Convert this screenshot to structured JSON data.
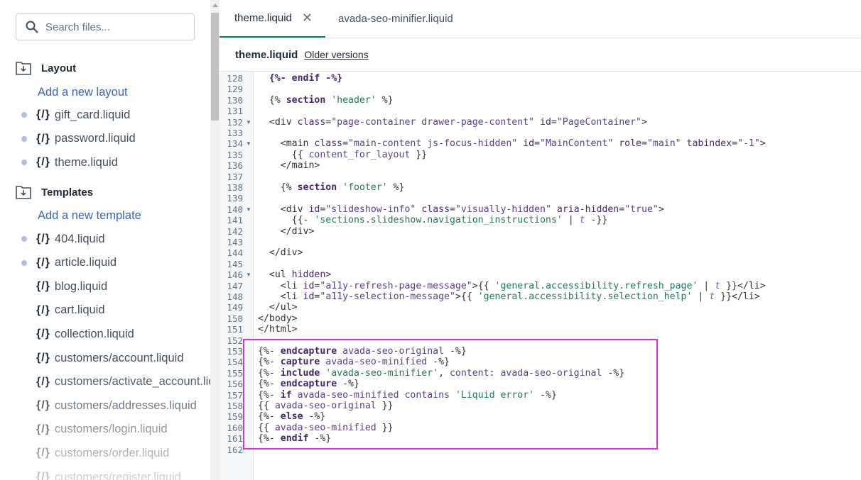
{
  "sidebar": {
    "search_placeholder": "Search files...",
    "layout": {
      "title": "Layout",
      "add_label": "Add a new layout",
      "files": [
        {
          "name": "gift_card.liquid",
          "modified": true
        },
        {
          "name": "password.liquid",
          "modified": true
        },
        {
          "name": "theme.liquid",
          "modified": true
        }
      ]
    },
    "templates": {
      "title": "Templates",
      "add_label": "Add a new template",
      "files": [
        {
          "name": "404.liquid",
          "modified": true
        },
        {
          "name": "article.liquid",
          "modified": true
        },
        {
          "name": "blog.liquid",
          "modified": false
        },
        {
          "name": "cart.liquid",
          "modified": false
        },
        {
          "name": "collection.liquid",
          "modified": false
        },
        {
          "name": "customers/account.liquid",
          "modified": false
        },
        {
          "name": "customers/activate_account.liquid",
          "modified": false
        },
        {
          "name": "customers/addresses.liquid",
          "modified": false
        },
        {
          "name": "customers/login.liquid",
          "modified": false
        },
        {
          "name": "customers/order.liquid",
          "modified": false
        },
        {
          "name": "customers/register.liquid",
          "modified": false
        }
      ]
    },
    "file_icon_text": "{/}"
  },
  "tabs": [
    {
      "label": "theme.liquid",
      "active": true,
      "close": "✕"
    },
    {
      "label": "avada-seo-minifier.liquid",
      "active": false
    }
  ],
  "file_header": {
    "name": "theme.liquid",
    "older_versions": "Older versions"
  },
  "code_lines": [
    {
      "n": "128",
      "fold": false,
      "html": "  <span class='k'>{%- endif -%}</span>"
    },
    {
      "n": "129",
      "fold": false,
      "html": ""
    },
    {
      "n": "130",
      "fold": false,
      "html": "  {% <span class='k'>section</span> <span class='s'>'header'</span> %}"
    },
    {
      "n": "131",
      "fold": false,
      "html": ""
    },
    {
      "n": "132",
      "fold": true,
      "html": "  &lt;div <span class='a'>class</span>=<span class='v'>\"page-container drawer-page-content\"</span> <span class='a'>id</span>=<span class='v'>\"PageContainer\"</span>&gt;"
    },
    {
      "n": "133",
      "fold": false,
      "html": ""
    },
    {
      "n": "134",
      "fold": true,
      "html": "    &lt;main <span class='a'>class</span>=<span class='v'>\"main-content js-focus-hidden\"</span> <span class='a'>id</span>=<span class='v'>\"MainContent\"</span> <span class='a'>role</span>=<span class='v'>\"main\"</span> <span class='a'>tabindex</span>=<span class='v'>\"-1\"</span>&gt;"
    },
    {
      "n": "135",
      "fold": false,
      "html": "      {{ <span class='v'>content_for_layout</span> }}"
    },
    {
      "n": "136",
      "fold": false,
      "html": "    &lt;/main&gt;"
    },
    {
      "n": "137",
      "fold": false,
      "html": ""
    },
    {
      "n": "138",
      "fold": false,
      "html": "    {% <span class='k'>section</span> <span class='s'>'footer'</span> %}"
    },
    {
      "n": "139",
      "fold": false,
      "html": ""
    },
    {
      "n": "140",
      "fold": true,
      "html": "    &lt;div <span class='a'>id</span>=<span class='v'>\"slideshow-info\"</span> <span class='a'>class</span>=<span class='v'>\"visually-hidden\"</span> <span class='a'>aria-hidden</span>=<span class='v'>\"true\"</span>&gt;"
    },
    {
      "n": "141",
      "fold": false,
      "html": "      {{- <span class='s'>'sections.slideshow.navigation_instructions'</span> | <span class='f'>t</span> -}}"
    },
    {
      "n": "142",
      "fold": false,
      "html": "    &lt;/div&gt;"
    },
    {
      "n": "143",
      "fold": false,
      "html": ""
    },
    {
      "n": "144",
      "fold": false,
      "html": "  &lt;/div&gt;"
    },
    {
      "n": "145",
      "fold": false,
      "html": ""
    },
    {
      "n": "146",
      "fold": true,
      "html": "  &lt;ul <span class='a'>hidden</span>&gt;"
    },
    {
      "n": "147",
      "fold": false,
      "html": "    &lt;li <span class='a'>id</span>=<span class='v'>\"a11y-refresh-page-message\"</span>&gt;{{ <span class='s'>'general.accessibility.refresh_page'</span> | <span class='f'>t</span> }}&lt;/li&gt;"
    },
    {
      "n": "148",
      "fold": false,
      "html": "    &lt;li <span class='a'>id</span>=<span class='v'>\"a11y-selection-message\"</span>&gt;{{ <span class='s'>'general.accessibility.selection_help'</span> | <span class='f'>t</span> }}&lt;/li&gt;"
    },
    {
      "n": "149",
      "fold": false,
      "html": "  &lt;/ul&gt;"
    },
    {
      "n": "150",
      "fold": false,
      "html": "&lt;/body&gt;"
    },
    {
      "n": "151",
      "fold": false,
      "html": "&lt;/html&gt;"
    },
    {
      "n": "152",
      "fold": false,
      "html": ""
    },
    {
      "n": "153",
      "fold": false,
      "html": "{%- <span class='k'>endcapture</span> <span class='v'>avada-seo-original</span> -%}"
    },
    {
      "n": "154",
      "fold": false,
      "html": "{%- <span class='k'>capture</span> <span class='v'>avada-seo-minified</span> -%}"
    },
    {
      "n": "155",
      "fold": false,
      "html": "{%- <span class='k'>include</span> <span class='s'>'avada-seo-minifier'</span>, <span class='v'>content</span>: <span class='v'>avada-seo-original</span> -%}"
    },
    {
      "n": "156",
      "fold": false,
      "html": "{%- <span class='k'>endcapture</span> -%}"
    },
    {
      "n": "157",
      "fold": false,
      "html": "{%- <span class='k'>if</span> <span class='v'>avada-seo-minified</span> <span class='v'>contains</span> <span class='s'>'Liquid error'</span> -%}"
    },
    {
      "n": "158",
      "fold": false,
      "html": "{{ <span class='v'>avada-seo-original</span> }}"
    },
    {
      "n": "159",
      "fold": false,
      "html": "{%- <span class='k'>else</span> -%}"
    },
    {
      "n": "160",
      "fold": false,
      "html": "{{ <span class='v'>avada-seo-minified</span> }}"
    },
    {
      "n": "161",
      "fold": false,
      "html": "{%- <span class='k'>endif</span> -%}"
    },
    {
      "n": "162",
      "fold": false,
      "html": ""
    }
  ],
  "colors": {
    "accent_tab": "#008060",
    "highlight_box": "#e02ddb",
    "link": "#3b62b8",
    "modified_dot": "#b4bde8"
  }
}
